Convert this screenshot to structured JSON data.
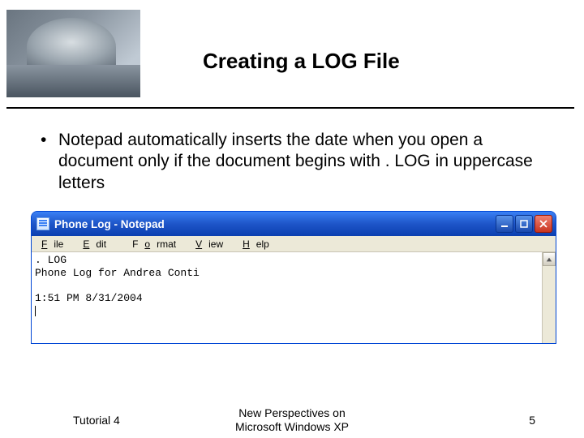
{
  "slide": {
    "title": "Creating a LOG File",
    "bullet": "Notepad automatically inserts the date when you open a document only if the document begins with . LOG in uppercase letters"
  },
  "notepad": {
    "title": "Phone Log - Notepad",
    "menus": {
      "file_u": "F",
      "file_r": "ile",
      "edit_u": "E",
      "edit_r": "dit",
      "format_u": "o",
      "format_pre": "F",
      "format_r": "rmat",
      "view_u": "V",
      "view_r": "iew",
      "help_u": "H",
      "help_r": "elp"
    },
    "content": {
      "line1": ". LOG",
      "line2": "Phone Log for Andrea Conti",
      "line3": "",
      "line4": "1:51 PM 8/31/2004"
    }
  },
  "footer": {
    "left": "Tutorial 4",
    "center_l1": "New Perspectives on",
    "center_l2": "Microsoft Windows XP",
    "page": "5"
  }
}
